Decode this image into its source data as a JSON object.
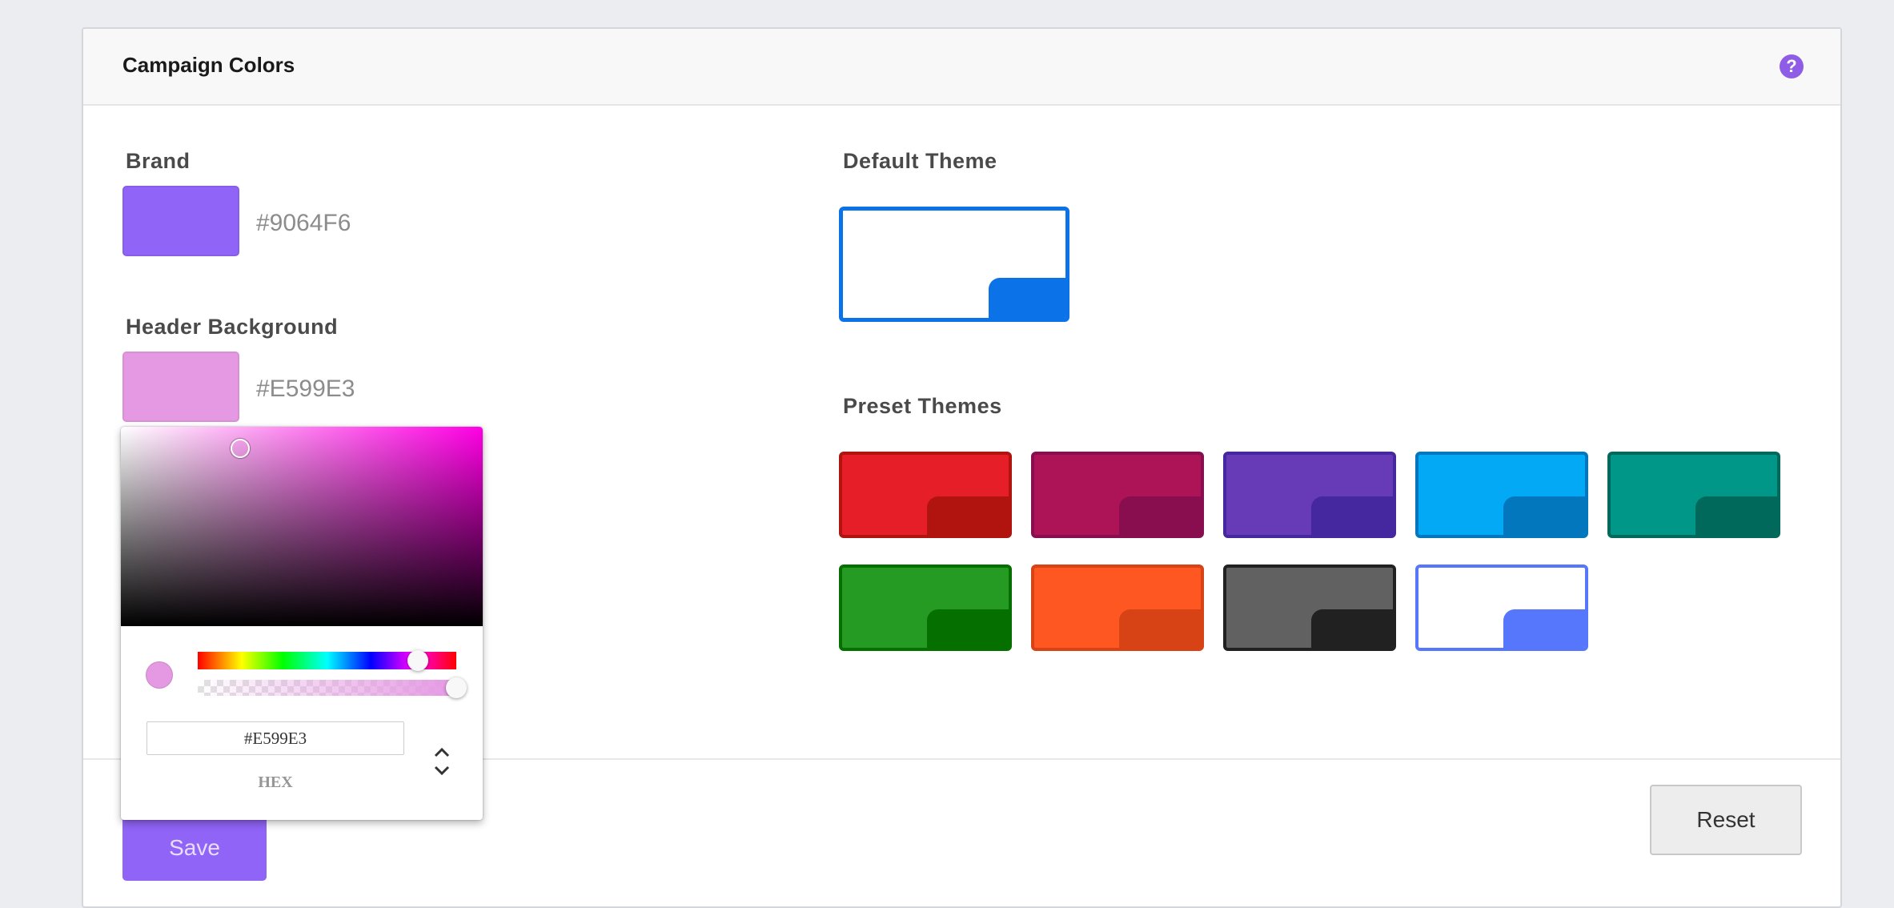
{
  "panel": {
    "title": "Campaign Colors",
    "help_glyph": "?"
  },
  "brand": {
    "label": "Brand",
    "hex": "#9064F6",
    "color": "#9064f6"
  },
  "header_background": {
    "label": "Header Background",
    "hex": "#E599E3",
    "color": "#e599e3"
  },
  "default_theme": {
    "label": "Default Theme",
    "border": "#0c72e8",
    "body": "#ffffff",
    "corner": "#0c72e8"
  },
  "preset_themes": {
    "label": "Preset Themes",
    "items": [
      {
        "name": "red",
        "body": "#e61e27",
        "corner": "#b1130e",
        "border": "#b1130e"
      },
      {
        "name": "crimson",
        "body": "#ad1457",
        "corner": "#880e4f",
        "border": "#880e4f"
      },
      {
        "name": "purple",
        "body": "#673ab7",
        "corner": "#4527a0",
        "border": "#4527a0"
      },
      {
        "name": "sky-blue",
        "body": "#03a9f4",
        "corner": "#0277bd",
        "border": "#0277bd"
      },
      {
        "name": "teal",
        "body": "#009688",
        "corner": "#00695c",
        "border": "#00695c"
      },
      {
        "name": "green",
        "body": "#259b24",
        "corner": "#056f00",
        "border": "#056f00"
      },
      {
        "name": "orange",
        "body": "#ff5722",
        "corner": "#d84315",
        "border": "#d84315"
      },
      {
        "name": "dark-gray",
        "body": "#616161",
        "corner": "#212121",
        "border": "#212121"
      },
      {
        "name": "white-periwinkle",
        "body": "#ffffff",
        "corner": "#5677fc",
        "border": "#5677fc"
      }
    ]
  },
  "picker": {
    "hue_color": "#ff00e4",
    "current_color": "#e599e3",
    "hex_value": "#E599E3",
    "mode_label": "HEX",
    "hue_fraction": 0.85,
    "alpha_fraction": 1.0
  },
  "footer": {
    "save_label": "Save",
    "reset_label": "Reset"
  }
}
